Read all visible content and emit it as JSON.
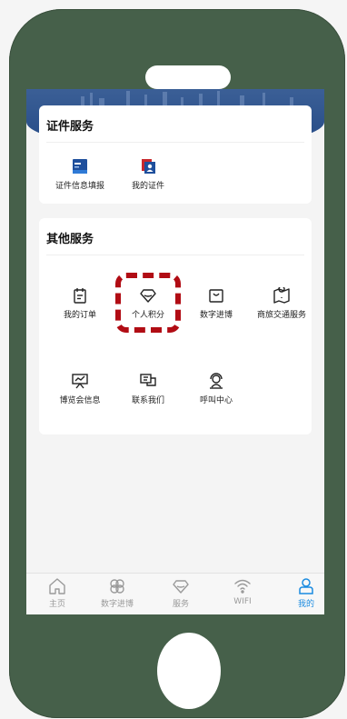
{
  "cert_section": {
    "title": "证件服务",
    "items": [
      {
        "label": "证件信息填报",
        "icon": "id-card-icon"
      },
      {
        "label": "我的证件",
        "icon": "badge-icon"
      }
    ]
  },
  "other_section": {
    "title": "其他服务",
    "items": [
      {
        "label": "我的订单",
        "icon": "order-clipboard-icon"
      },
      {
        "label": "个人积分",
        "icon": "diamond-icon"
      },
      {
        "label": "数字进博",
        "icon": "shopping-bag-icon"
      },
      {
        "label": "商旅交通服务",
        "icon": "map-pin-icon"
      },
      {
        "label": "博览会信息",
        "icon": "presentation-chart-icon"
      },
      {
        "label": "联系我们",
        "icon": "chat-icon"
      },
      {
        "label": "呼叫中心",
        "icon": "headset-icon"
      }
    ]
  },
  "tabbar": {
    "tabs": [
      {
        "label": "主页",
        "icon": "home-icon",
        "active": false
      },
      {
        "label": "数字进博",
        "icon": "clover-icon",
        "active": false
      },
      {
        "label": "服务",
        "icon": "diamond-icon",
        "active": false
      },
      {
        "label": "WIFI",
        "icon": "wifi-icon",
        "active": false
      },
      {
        "label": "我的",
        "icon": "user-icon",
        "active": true
      }
    ]
  },
  "colors": {
    "phone_body": "#46604a",
    "hero": "#2b4f8a",
    "highlight": "#b10c14",
    "active_tab": "#1a8be0"
  }
}
